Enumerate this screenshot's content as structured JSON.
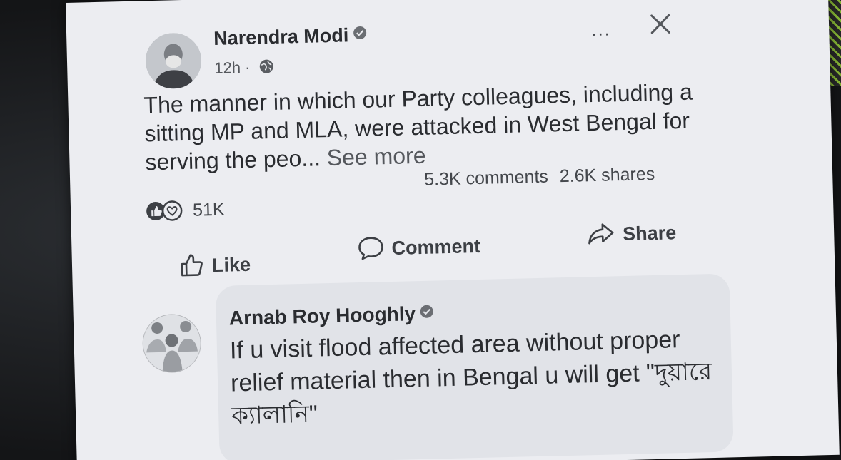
{
  "post": {
    "author": "Narendra Modi",
    "time": "12h",
    "time_separator": "·",
    "text": "The manner in which our Party colleagues, including a sitting MP and MLA, were attacked in West Bengal for serving the peo...",
    "see_more": "See more",
    "reactions_count": "51K",
    "comments_count": "5.3K comments",
    "shares_count": "2.6K shares",
    "more_menu": "...",
    "icons": [
      "verified-badge-icon",
      "globe-icon",
      "more-options-icon",
      "close-icon",
      "like-reaction-icon",
      "love-reaction-icon"
    ]
  },
  "actions": {
    "like": "Like",
    "comment": "Comment",
    "share": "Share"
  },
  "comment": {
    "author": "Arnab Roy Hooghly",
    "text": "If u visit flood affected area without proper relief material then in Bengal u will get \"দুয়ারে ক্যালানি\""
  }
}
